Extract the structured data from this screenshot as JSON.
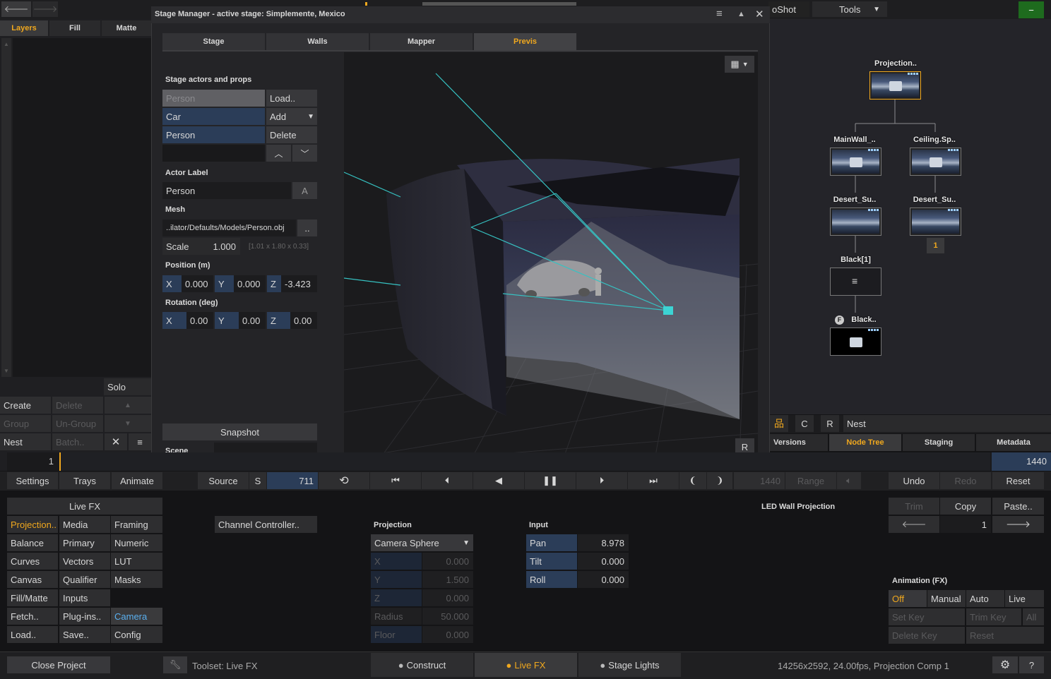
{
  "topbar": {
    "back_label": "🡐",
    "fwd_label": "🡒",
    "right_title_fragment": "oShot",
    "tools_label": "Tools",
    "minus_label": "−"
  },
  "left_panel": {
    "tabs": [
      "Layers",
      "Fill",
      "Matte"
    ],
    "solo_label": "Solo",
    "buttons": {
      "create": "Create",
      "delete": "Delete",
      "group": "Group",
      "ungroup": "Un-Group",
      "nest": "Nest",
      "batch": "Batch.."
    },
    "frame_value": "1"
  },
  "stage_manager": {
    "title": "Stage Manager - active stage: Simplemente, Mexico",
    "tabs": [
      "Stage",
      "Walls",
      "Mapper",
      "Previs"
    ],
    "active_tab": "Previs",
    "actors_header": "Stage actors and props",
    "actor_list": [
      "Person",
      "Car",
      "Person"
    ],
    "actor_buttons": {
      "load": "Load..",
      "add": "Add",
      "delete": "Delete"
    },
    "actor_label_header": "Actor Label",
    "actor_label_value": "Person",
    "actor_label_button": "A",
    "mesh_header": "Mesh",
    "mesh_path": "..ilator/Defaults/Models/Person.obj",
    "mesh_browse": "..",
    "scale_label": "Scale",
    "scale_value": "1.000",
    "scale_dims": "[1.01 x 1.80 x 0.33]",
    "position_header": "Position (m)",
    "position": {
      "x_label": "X",
      "x": "0.000",
      "y_label": "Y",
      "y": "0.000",
      "z_label": "Z",
      "z": "-3.423"
    },
    "rotation_header": "Rotation (deg)",
    "rotation": {
      "x_label": "X",
      "x": "0.00",
      "y_label": "Y",
      "y": "0.00",
      "z_label": "Z",
      "z": "0.00"
    },
    "snapshot_label": "Snapshot",
    "scene_label": "Scene",
    "viewport_reset": "R"
  },
  "node_graph": {
    "nodes": [
      {
        "label": "Projection.."
      },
      {
        "label": "MainWall_.."
      },
      {
        "label": "Ceiling.Sp.."
      },
      {
        "label": "Desert_Su.."
      },
      {
        "label": "Desert_Su.."
      },
      {
        "label": "Black[1]"
      },
      {
        "label": "Black.."
      }
    ],
    "badge": "1",
    "f_badge": "F",
    "toolbar": {
      "c": "C",
      "r": "R",
      "nest": "Nest"
    },
    "tabs": [
      "Versions",
      "Node Tree",
      "Staging",
      "Metadata"
    ],
    "active_tab": "Node Tree"
  },
  "timeline": {
    "end_frame": "1440"
  },
  "transport": {
    "settings": "Settings",
    "trays": "Trays",
    "animate": "Animate",
    "source": "Source",
    "s": "S",
    "frame": "711",
    "end_frame": "1440",
    "range": "Range",
    "undo": "Undo",
    "redo": "Redo",
    "reset": "Reset"
  },
  "fx_menu": {
    "title": "Live FX",
    "items": [
      [
        "Projection..",
        "Media",
        "Framing"
      ],
      [
        "Balance",
        "Primary",
        "Numeric"
      ],
      [
        "Curves",
        "Vectors",
        "LUT"
      ],
      [
        "Canvas",
        "Qualifier",
        "Masks"
      ],
      [
        "Fill/Matte",
        "Inputs",
        ""
      ],
      [
        "Fetch..",
        "Plug-ins..",
        "Camera"
      ],
      [
        "Load..",
        "Save..",
        "Config"
      ]
    ]
  },
  "channel_controller": "Channel Controller..",
  "projection": {
    "header": "Projection",
    "mode": "Camera Sphere",
    "fields": [
      {
        "label": "X",
        "value": "0.000"
      },
      {
        "label": "Y",
        "value": "1.500"
      },
      {
        "label": "Z",
        "value": "0.000"
      },
      {
        "label": "Radius",
        "value": "50.000"
      },
      {
        "label": "Floor",
        "value": "0.000"
      }
    ]
  },
  "input": {
    "header": "Input",
    "fields": [
      {
        "label": "Pan",
        "value": "8.978"
      },
      {
        "label": "Tilt",
        "value": "0.000"
      },
      {
        "label": "Roll",
        "value": "0.000"
      }
    ]
  },
  "led_title": "LED Wall Projection",
  "clipboard": {
    "trim": "Trim",
    "copy": "Copy",
    "paste": "Paste..",
    "index": "1"
  },
  "animation": {
    "header": "Animation (FX)",
    "modes": [
      "Off",
      "Manual",
      "Auto",
      "Live"
    ],
    "set_key": "Set Key",
    "trim_key": "Trim Key",
    "all": "All",
    "delete_key": "Delete Key",
    "reset": "Reset"
  },
  "statusbar": {
    "close_project": "Close Project",
    "toolset": "Toolset: Live FX",
    "tabs": [
      "Construct",
      "Live FX",
      "Stage Lights"
    ],
    "active_tab": "Live FX",
    "info": "14256x2592, 24.00fps, Projection Comp 1",
    "help": "?"
  },
  "colors": {
    "accent": "#f0a81e",
    "highlight_blue": "#5ab0f0",
    "panel": "#2e2e30",
    "field_blue": "#2b3d58"
  }
}
